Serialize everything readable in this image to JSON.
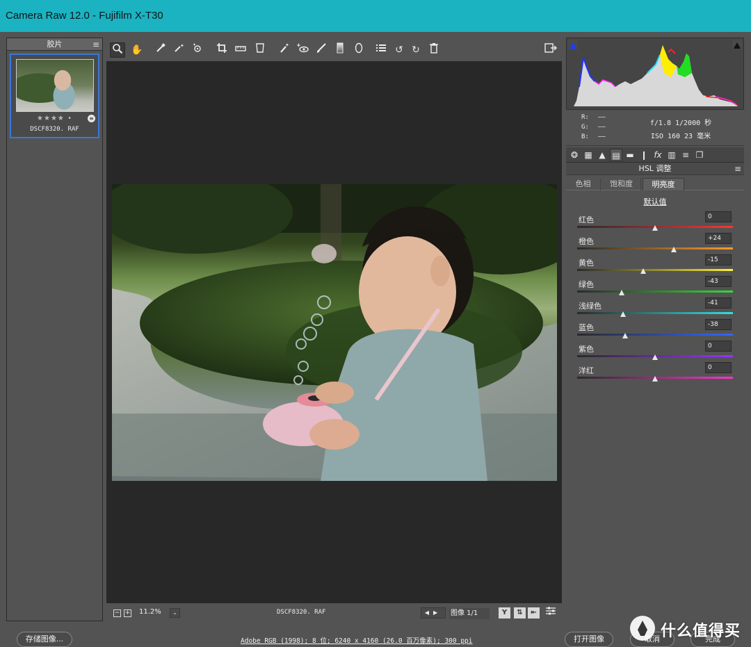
{
  "window": {
    "title": "Camera Raw 12.0 -  Fujifilm X-T30"
  },
  "filmstrip": {
    "title": "胶片",
    "thumbnail": {
      "filename": "DSCF8320. RAF",
      "stars": "★★★★ •"
    }
  },
  "toolbar": {
    "tools": [
      "zoom-tool",
      "hand-tool",
      "white-balance-tool",
      "color-sampler-tool",
      "targeted-adjustment-tool",
      "crop-tool",
      "straighten-tool",
      "transform-tool",
      "spot-removal-tool",
      "red-eye-tool",
      "adjustment-brush",
      "graduated-filter",
      "radial-filter",
      "preferences",
      "rotate-left",
      "rotate-right",
      "trash"
    ],
    "active_tool": "zoom-tool"
  },
  "canvas_bar": {
    "zoom": "11.2%",
    "filename": "DSCF8320. RAF",
    "image_count": "图像 1/1",
    "view_label": "Y"
  },
  "histogram": {
    "rgb": {
      "r_label": "R:",
      "g_label": "G:",
      "b_label": "B:",
      "r": "——",
      "g": "——",
      "b": "——"
    },
    "exposure_line1": "f/1.8   1/2000 秒",
    "exposure_line2": "ISO 160   23 毫米"
  },
  "hsl": {
    "title": "HSL 调整",
    "tabs": [
      "色相",
      "饱和度",
      "明亮度"
    ],
    "active_tab": "明亮度",
    "default_label": "默认值",
    "sliders": [
      {
        "label": "红色",
        "value": "0",
        "amount": 0
      },
      {
        "label": "橙色",
        "value": "+24",
        "amount": 24
      },
      {
        "label": "黄色",
        "value": "-15",
        "amount": -15
      },
      {
        "label": "绿色",
        "value": "-43",
        "amount": -43
      },
      {
        "label": "浅绿色",
        "value": "-41",
        "amount": -41
      },
      {
        "label": "蓝色",
        "value": "-38",
        "amount": -38
      },
      {
        "label": "紫色",
        "value": "0",
        "amount": 0
      },
      {
        "label": "洋红",
        "value": "0",
        "amount": 0
      }
    ]
  },
  "footer": {
    "save_label": "存储图像...",
    "info": "Adobe RGB (1998); 8 位; 6240 x 4160 (26.0 百万像素); 300 ppi",
    "open_label": "打开图像",
    "cancel_label": "取消",
    "done_label": "完成"
  },
  "watermark": {
    "text": "什么值得买"
  },
  "colors": {
    "titlebar": "#1bb3c1",
    "panel": "#535353",
    "canvas": "#282828",
    "selection": "#3a78d6"
  }
}
